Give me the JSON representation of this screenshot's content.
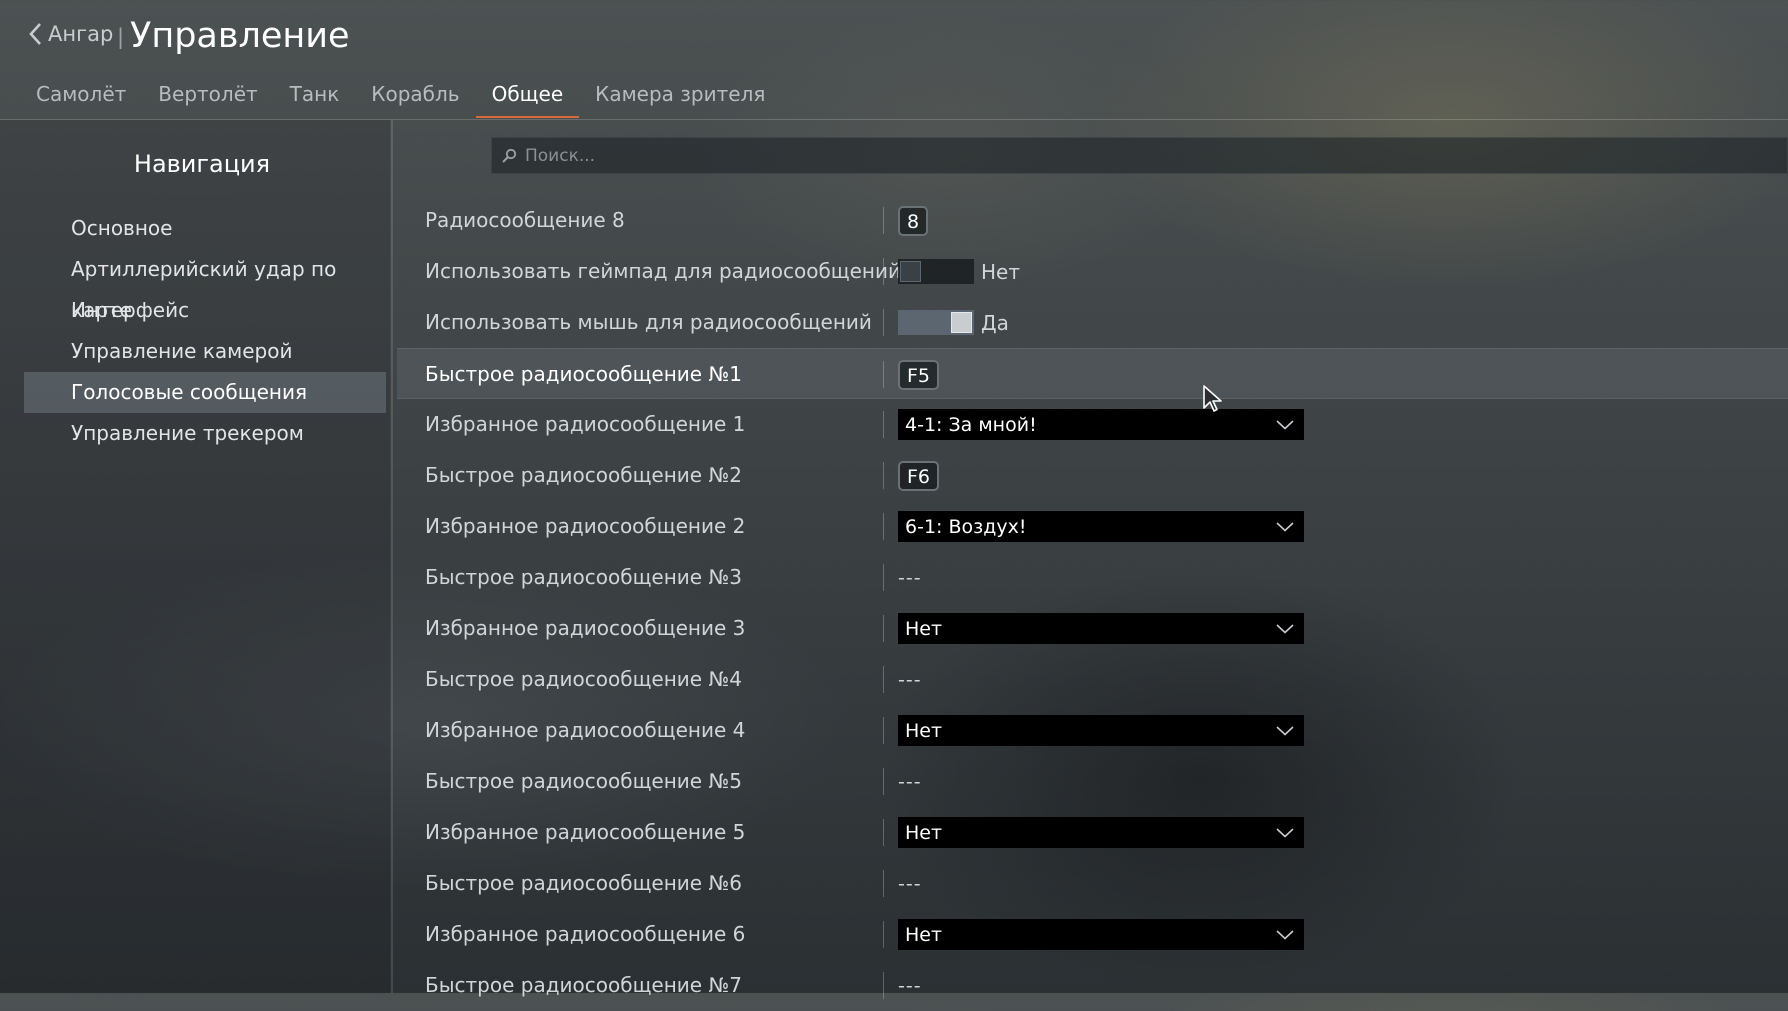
{
  "header": {
    "back_label": "Ангар",
    "separator": "|",
    "title": "Управление"
  },
  "tabs": [
    {
      "label": "Самолёт",
      "active": false
    },
    {
      "label": "Вертолёт",
      "active": false
    },
    {
      "label": "Танк",
      "active": false
    },
    {
      "label": "Корабль",
      "active": false
    },
    {
      "label": "Общее",
      "active": true
    },
    {
      "label": "Камера зрителя",
      "active": false
    }
  ],
  "sidebar": {
    "title": "Навигация",
    "items": [
      {
        "label": "Основное"
      },
      {
        "label": "Артиллерийский удар по карте"
      },
      {
        "label": "Интерфейс"
      },
      {
        "label": "Управление камерой"
      },
      {
        "label": "Голосовые сообщения",
        "selected": true
      },
      {
        "label": "Управление трекером"
      }
    ]
  },
  "search": {
    "placeholder": "Поиск..."
  },
  "rows": [
    {
      "label": "Радиосообщение 8",
      "type": "key",
      "value": "8"
    },
    {
      "label": "Использовать геймпад для радиосообщений",
      "type": "toggle",
      "on": false,
      "value": "Нет"
    },
    {
      "label": "Использовать мышь для радиосообщений",
      "type": "toggle",
      "on": true,
      "value": "Да"
    },
    {
      "label": "Быстрое радиосообщение №1",
      "type": "key",
      "value": "F5",
      "highlighted": true
    },
    {
      "label": "Избранное радиосообщение 1",
      "type": "select",
      "value": "4-1: За мной!"
    },
    {
      "label": "Быстрое радиосообщение №2",
      "type": "key",
      "value": "F6"
    },
    {
      "label": "Избранное радиосообщение 2",
      "type": "select",
      "value": "6-1: Воздух!"
    },
    {
      "label": "Быстрое радиосообщение №3",
      "type": "dash",
      "value": "---"
    },
    {
      "label": "Избранное радиосообщение 3",
      "type": "select",
      "value": "Нет"
    },
    {
      "label": "Быстрое радиосообщение №4",
      "type": "dash",
      "value": "---"
    },
    {
      "label": "Избранное радиосообщение 4",
      "type": "select",
      "value": "Нет"
    },
    {
      "label": "Быстрое радиосообщение №5",
      "type": "dash",
      "value": "---"
    },
    {
      "label": "Избранное радиосообщение 5",
      "type": "select",
      "value": "Нет"
    },
    {
      "label": "Быстрое радиосообщение №6",
      "type": "dash",
      "value": "---"
    },
    {
      "label": "Избранное радиосообщение 6",
      "type": "select",
      "value": "Нет"
    },
    {
      "label": "Быстрое радиосообщение №7",
      "type": "dash",
      "value": "---"
    }
  ],
  "icons": {
    "back": "chevron-left-icon",
    "search": "search-icon",
    "dropdown": "chevron-down-icon",
    "cursor": "mouse-pointer-icon"
  },
  "colors": {
    "accent_tab_underline": "#d9683a",
    "select_background": "#000000",
    "nav_selected": "#5f6970"
  }
}
